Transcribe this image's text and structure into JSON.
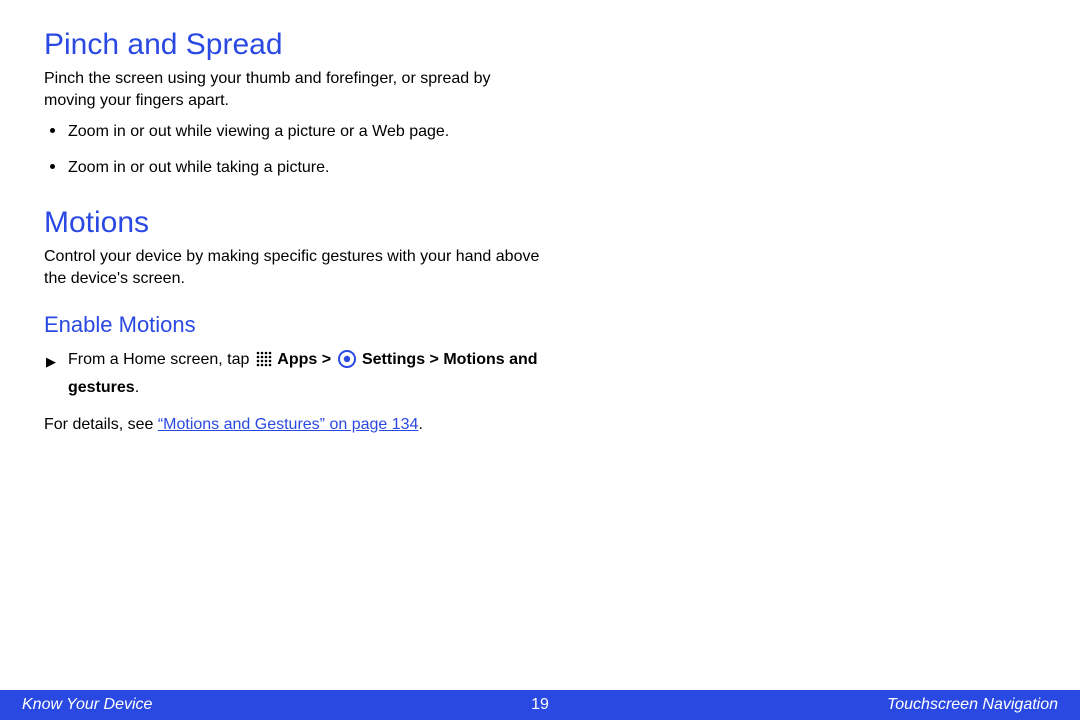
{
  "section1": {
    "title": "Pinch and Spread",
    "intro": "Pinch the screen using your thumb and forefinger, or spread by moving your fingers apart.",
    "bullets": [
      "Zoom in or out while viewing a picture or a Web page.",
      "Zoom in or out while taking a picture."
    ]
  },
  "section2": {
    "title": "Motions",
    "intro": "Control your device by making specific gestures with your hand above the device's screen."
  },
  "subsection": {
    "title": "Enable Motions",
    "step_prefix": "From a Home screen, tap ",
    "step_apps": "Apps",
    "step_sep1": " > ",
    "step_settings": "Settings",
    "step_sep2": " > ",
    "step_motions": "Motions and gestures",
    "step_suffix": ".",
    "ref_prefix": "For details, see ",
    "ref_link": "“Motions and Gestures” on page 134",
    "ref_suffix": "."
  },
  "footer": {
    "left": "Know Your Device",
    "page": "19",
    "right": "Touchscreen Navigation"
  }
}
